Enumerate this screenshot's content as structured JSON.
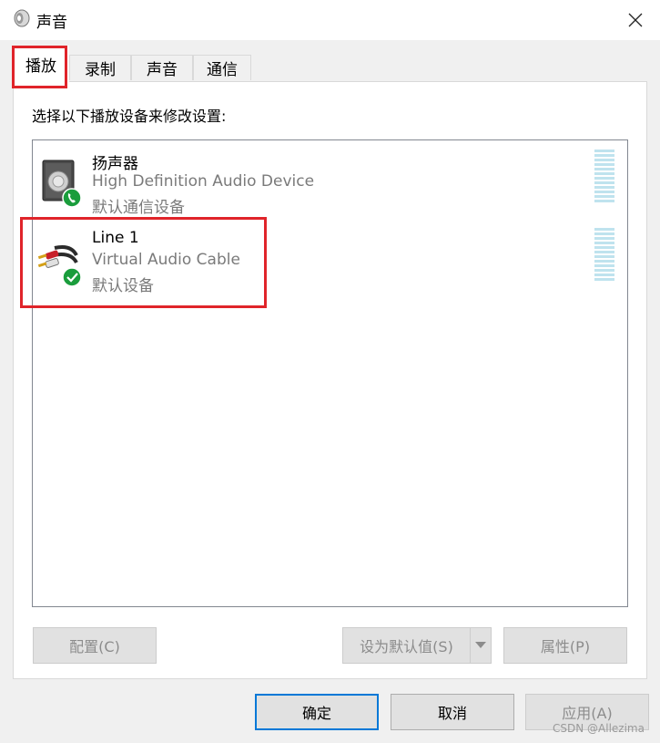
{
  "window": {
    "title": "声音"
  },
  "tabs": [
    {
      "label": "播放",
      "selected": true
    },
    {
      "label": "录制",
      "selected": false
    },
    {
      "label": "声音",
      "selected": false
    },
    {
      "label": "通信",
      "selected": false
    }
  ],
  "playback": {
    "instruction": "选择以下播放设备来修改设置:",
    "devices": [
      {
        "name": "扬声器",
        "description": "High Definition Audio Device",
        "status": "默认通信设备",
        "icon": "speaker-icon",
        "badge": "phone-badge-icon"
      },
      {
        "name": "Line 1",
        "description": "Virtual Audio Cable",
        "status": "默认设备",
        "icon": "audio-cable-icon",
        "badge": "check-badge-icon"
      }
    ],
    "buttons": {
      "configure": "配置(C)",
      "set_default": "设为默认值(S)",
      "properties": "属性(P)"
    }
  },
  "footer": {
    "ok": "确定",
    "cancel": "取消",
    "apply": "应用(A)"
  },
  "watermark": "CSDN @Allezima",
  "colors": {
    "highlight_red": "#e0242a",
    "focus_blue": "#0078d7",
    "badge_green": "#1a9d3c"
  }
}
